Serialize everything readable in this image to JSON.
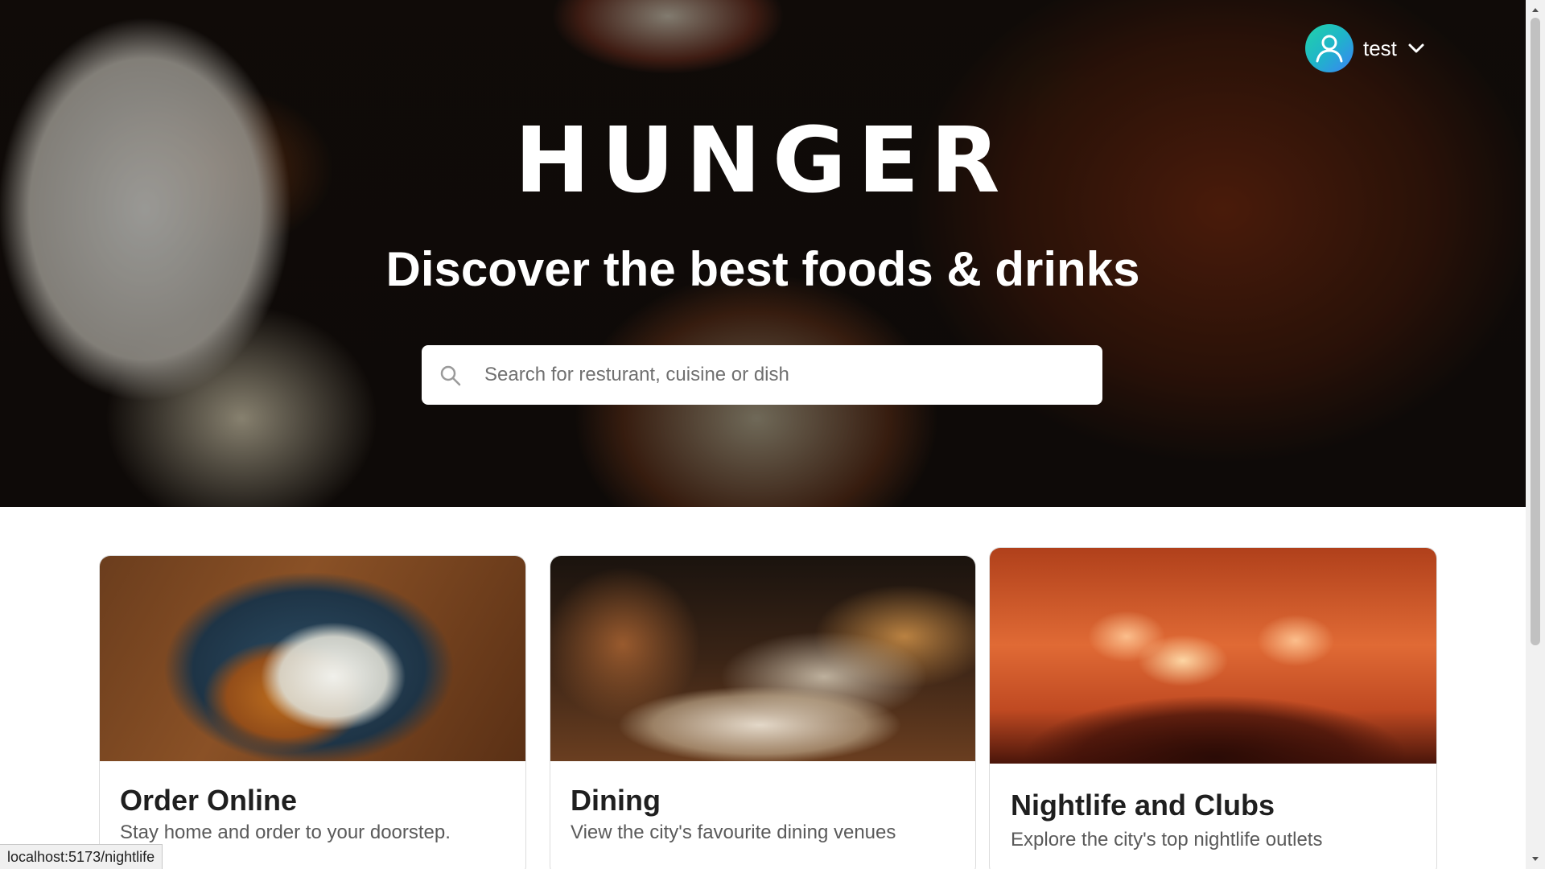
{
  "user": {
    "name": "test"
  },
  "hero": {
    "brand": "HUNGER",
    "tagline": "Discover the best foods & drinks",
    "search_placeholder": "Search for resturant, cuisine or dish"
  },
  "cards": [
    {
      "title": "Order Online",
      "description": "Stay home and order to your doorstep."
    },
    {
      "title": "Dining",
      "description": "View the city's favourite dining venues"
    },
    {
      "title": "Nightlife and Clubs",
      "description": "Explore the city's top nightlife outlets"
    }
  ],
  "status_bar": {
    "url": "localhost:5173/nightlife"
  },
  "icons": {
    "avatar": "user-avatar-icon",
    "dropdown": "chevron-down-icon",
    "search": "search-icon"
  },
  "colors": {
    "avatar_gradient_start": "#22d3a8",
    "avatar_gradient_end": "#3b82f6",
    "card_title": "#1f1f1f",
    "card_description": "#5a5a5a"
  }
}
